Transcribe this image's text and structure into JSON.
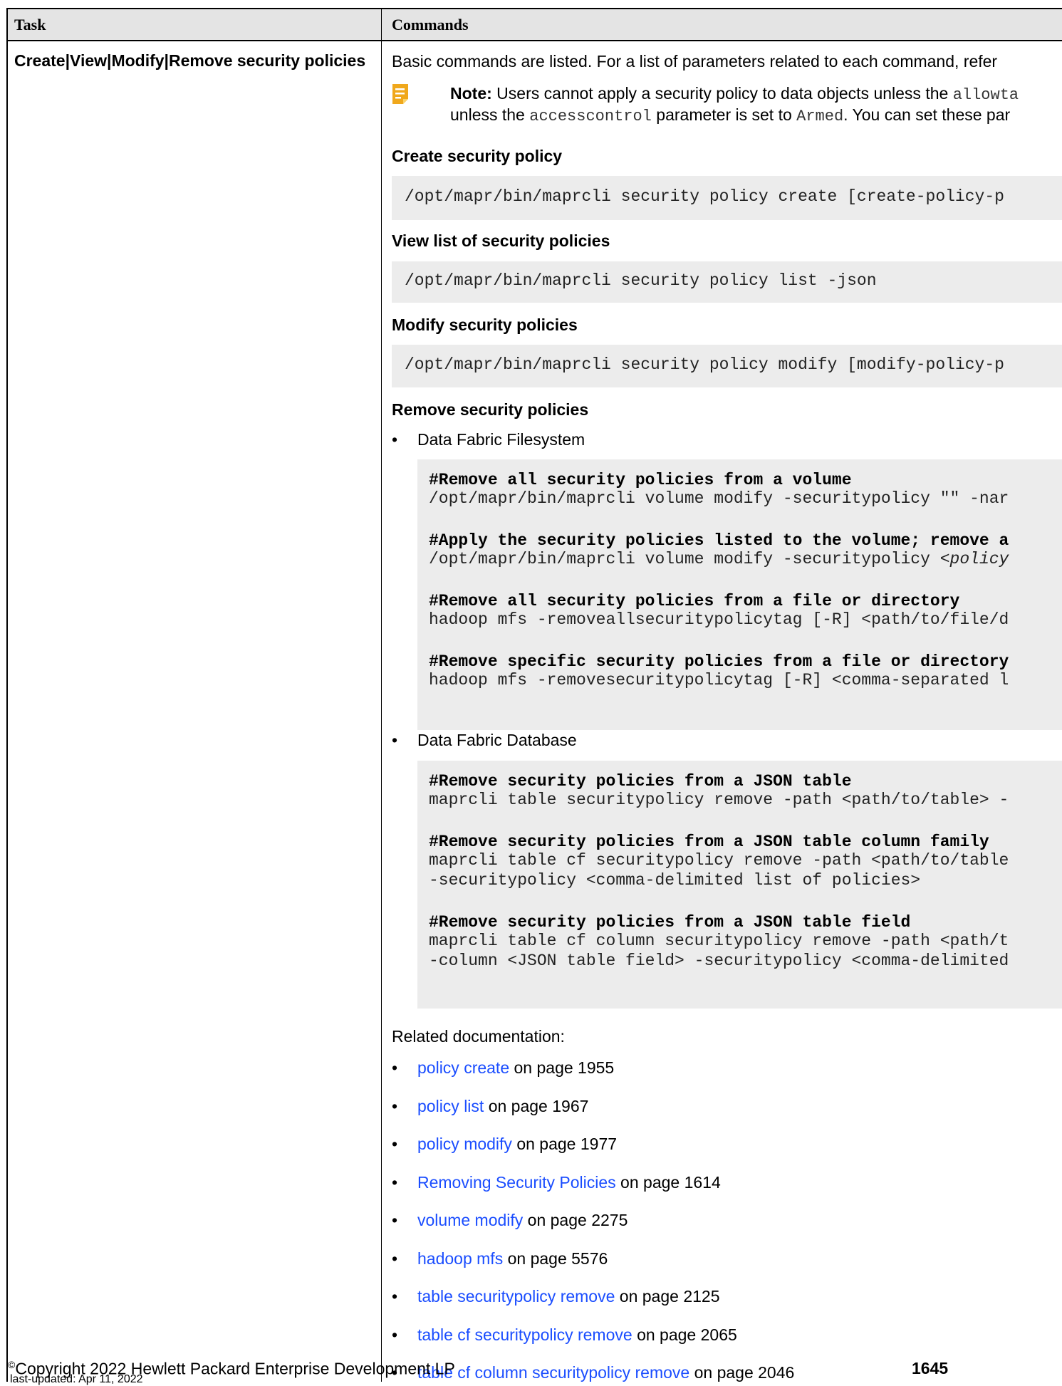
{
  "table": {
    "header": {
      "task": "Task",
      "commands": "Commands"
    },
    "task": "Create|View|Modify|Remove security policies",
    "intro": "Basic commands are listed. For a list of parameters related to each command, refer",
    "note": {
      "icon": "note-icon",
      "label": "Note:",
      "line1_pre": "Users cannot apply a security policy to data objects unless the",
      "line1_code": "allowta",
      "line2_pre": "unless the",
      "line2_code": "accesscontrol",
      "line2_mid": "parameter is set to",
      "line2_code2": "Armed",
      "line2_post": ". You can set these par"
    },
    "create": {
      "heading": "Create security policy",
      "code": "/opt/mapr/bin/maprcli security policy create [create-policy-p"
    },
    "list": {
      "heading": "View list of security policies",
      "code": "/opt/mapr/bin/maprcli security policy list -json"
    },
    "modify": {
      "heading": "Modify security policies",
      "code": "/opt/mapr/bin/maprcli security policy modify [modify-policy-p"
    },
    "remove": {
      "heading": "Remove security policies",
      "filesystem": {
        "bullet": "Data Fabric Filesystem",
        "c1": "#Remove all security policies from a volume",
        "c2": "/opt/mapr/bin/maprcli volume modify -securitypolicy \"\" -nar",
        "c3": "#Apply the security policies listed to the volume; remove a",
        "c4_pre": "/opt/mapr/bin/maprcli volume modify -securitypolicy <",
        "c4_it": "policy",
        "c5": "#Remove all security policies from a file or directory",
        "c6": "hadoop mfs -removeallsecuritypolicytag [-R] <path/to/file/d",
        "c7": "#Remove specific security policies from a file or directory",
        "c8": "hadoop mfs -removesecuritypolicytag [-R] <comma-separated l"
      },
      "database": {
        "bullet": "Data Fabric Database",
        "c1": "#Remove security policies from a JSON table",
        "c2": "maprcli table securitypolicy remove -path <path/to/table> -",
        "c3": "#Remove security policies from a JSON table column family",
        "c4": "maprcli table cf securitypolicy remove -path <path/to/table",
        "c5": "-securitypolicy <comma-delimited list of policies>",
        "c6": "#Remove security policies from a JSON table field",
        "c7": "maprcli table cf column securitypolicy remove -path <path/t",
        "c8": "-column <JSON table field> -securitypolicy <comma-delimited"
      }
    },
    "related": {
      "heading": "Related documentation:",
      "items": [
        {
          "link": "policy create",
          "page": " on page 1955"
        },
        {
          "link": "policy list",
          "page": " on page 1967"
        },
        {
          "link": "policy modify",
          "page": " on page 1977"
        },
        {
          "link": "Removing Security Policies",
          "page": " on page 1614"
        },
        {
          "link": "volume modify",
          "page": " on page 2275"
        },
        {
          "link": "hadoop mfs",
          "page": " on page 5576"
        },
        {
          "link": "table securitypolicy remove",
          "page": " on page 2125"
        },
        {
          "link": "table cf securitypolicy remove",
          "page": " on page 2065"
        },
        {
          "link": "table cf column securitypolicy remove",
          "page": " on page 2046"
        }
      ]
    }
  },
  "footer": {
    "copyright_symbol": "©",
    "copyright": "Copyright 2022 Hewlett Packard Enterprise Development LP",
    "updated": "last-updated: Apr 11, 2022",
    "page": "1645"
  },
  "colors": {
    "link": "#1a4dff",
    "header_bg": "#e4e4e4",
    "code_bg": "#ececec",
    "note_icon": "#f0a81c"
  }
}
